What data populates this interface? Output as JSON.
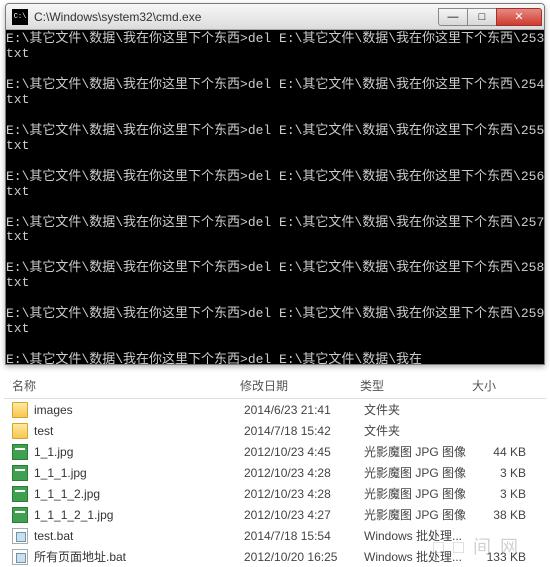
{
  "cmd": {
    "title": "C:\\Windows\\system32\\cmd.exe",
    "controls": {
      "min": "—",
      "max": "□",
      "close": "✕"
    },
    "prompt_path": "E:\\其它文件\\数据\\我在你这里下个东西>",
    "cmd_word": "del",
    "target_prefix": "E:\\其它文件\\数据\\我在你这里下个东西\\",
    "target_prefix_short": "E:\\其它文件\\数据\\我在",
    "ext_line": "txt",
    "nums": [
      "253.",
      "254.",
      "255.",
      "256.",
      "257.",
      "258.",
      "259."
    ]
  },
  "explorer": {
    "headers": {
      "name": "名称",
      "date": "修改日期",
      "type": "类型",
      "size": "大小"
    },
    "files": [
      {
        "icon": "folder",
        "name": "images",
        "date": "2014/6/23 21:41",
        "type": "文件夹",
        "size": ""
      },
      {
        "icon": "folder",
        "name": "test",
        "date": "2014/7/18 15:42",
        "type": "文件夹",
        "size": ""
      },
      {
        "icon": "jpg",
        "name": "1_1.jpg",
        "date": "2012/10/23 4:45",
        "type": "光影魔图 JPG 图像",
        "size": "44 KB"
      },
      {
        "icon": "jpg",
        "name": "1_1_1.jpg",
        "date": "2012/10/23 4:28",
        "type": "光影魔图 JPG 图像",
        "size": "3 KB"
      },
      {
        "icon": "jpg",
        "name": "1_1_1_2.jpg",
        "date": "2012/10/23 4:28",
        "type": "光影魔图 JPG 图像",
        "size": "3 KB"
      },
      {
        "icon": "jpg",
        "name": "1_1_1_2_1.jpg",
        "date": "2012/10/23 4:27",
        "type": "光影魔图 JPG 图像",
        "size": "38 KB"
      },
      {
        "icon": "bat",
        "name": "test.bat",
        "date": "2014/7/18 15:54",
        "type": "Windows 批处理...",
        "size": ""
      },
      {
        "icon": "bat",
        "name": "所有页面地址.bat",
        "date": "2012/10/20 16:25",
        "type": "Windows 批处理...",
        "size": "133 KB"
      }
    ]
  },
  "watermark": "□ □ 间 网"
}
